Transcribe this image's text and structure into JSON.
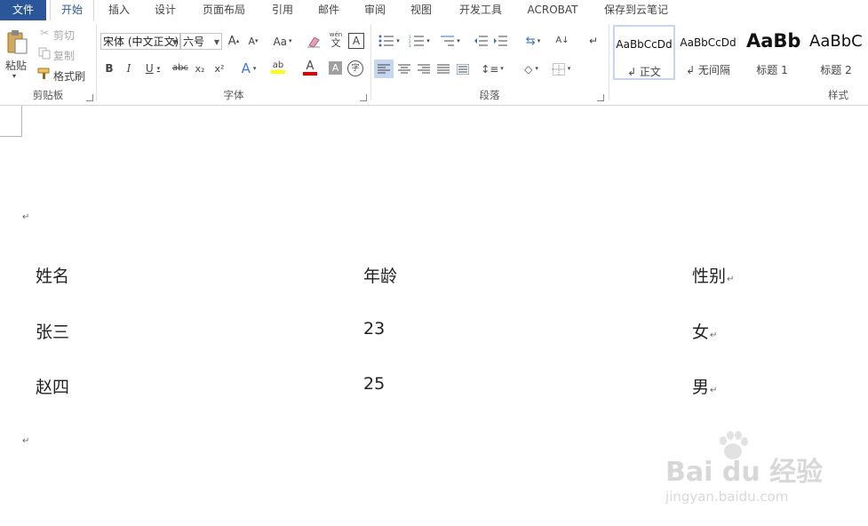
{
  "tabs": [
    {
      "label": "文件"
    },
    {
      "label": "开始"
    },
    {
      "label": "插入"
    },
    {
      "label": "设计"
    },
    {
      "label": "页面布局"
    },
    {
      "label": "引用"
    },
    {
      "label": "邮件"
    },
    {
      "label": "审阅"
    },
    {
      "label": "视图"
    },
    {
      "label": "开发工具"
    },
    {
      "label": "ACROBAT"
    },
    {
      "label": "保存到云笔记"
    }
  ],
  "clipboard": {
    "group_label": "剪贴板",
    "paste_label": "粘贴",
    "cut_label": "剪切",
    "copy_label": "复制",
    "format_painter_label": "格式刷"
  },
  "font": {
    "group_label": "字体",
    "font_name": "宋体 (中文正文)",
    "font_size": "六号",
    "change_case": "Aa",
    "phonetic_top": "wén",
    "phonetic_bottom": "文",
    "char_border": "A",
    "bold": "B",
    "italic": "I",
    "underline": "U",
    "strike": "abc",
    "subscript": "x₂",
    "superscript": "x²",
    "enclose": "字",
    "highlight_color": "#ffff00",
    "font_color": "#e00000"
  },
  "paragraph": {
    "group_label": "段落"
  },
  "styles": {
    "group_label": "样式",
    "items": [
      {
        "sample": "AaBbCcDd",
        "name": "↲ 正文"
      },
      {
        "sample": "AaBbCcDd",
        "name": "↲ 无间隔"
      },
      {
        "sample": "AaBb",
        "name": "标题 1"
      },
      {
        "sample": "AaBbC",
        "name": "标题 2"
      }
    ]
  },
  "document": {
    "paragraph_mark": "↵",
    "table": {
      "headers": [
        "姓名",
        "年龄",
        "性别"
      ],
      "rows": [
        [
          "张三",
          "23",
          "女"
        ],
        [
          "赵四",
          "25",
          "男"
        ]
      ]
    }
  },
  "watermark": {
    "brand": "Bai du 经验",
    "url": "jingyan.baidu.com"
  },
  "colors": {
    "accent": "#2b579a",
    "ribbon_bg": "#ffffff"
  }
}
